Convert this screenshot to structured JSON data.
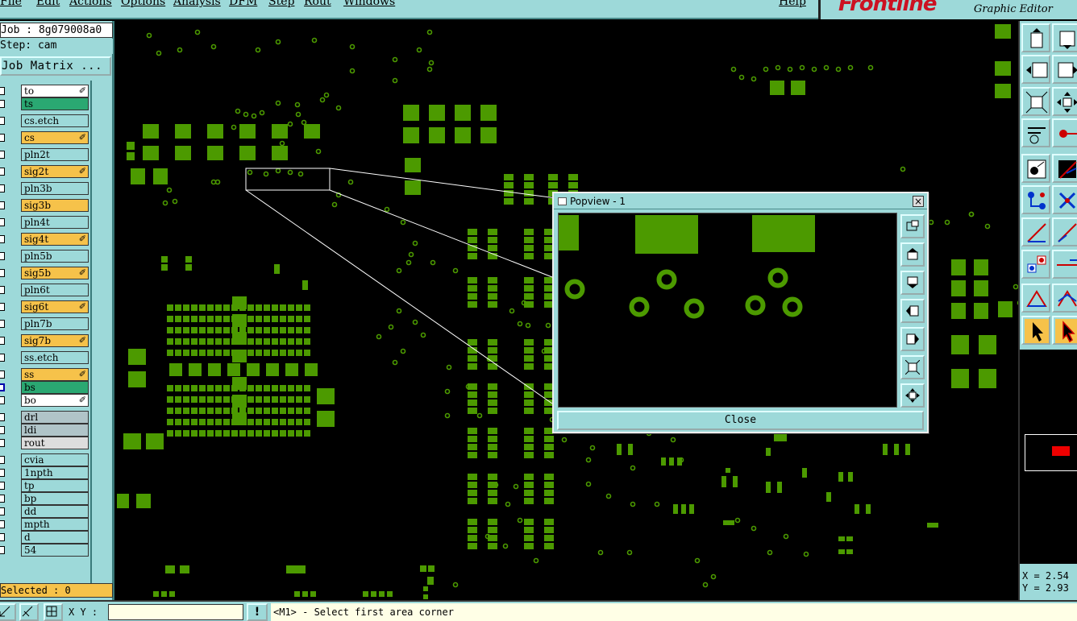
{
  "menubar": {
    "items": [
      "File",
      "Edit",
      "Actions",
      "Options",
      "Analysis",
      "DFM",
      "Step",
      "Rout",
      "Windows",
      "Help"
    ]
  },
  "brand": {
    "logo": "Frontline",
    "subtitle": "Graphic Editor"
  },
  "job": {
    "job_label": "Job : 8g079008a0",
    "step_label": "Step: cam",
    "matrix_button": "Job Matrix ..."
  },
  "layers": [
    {
      "name": "to",
      "color": "#ffffff",
      "editable": true
    },
    {
      "name": "ts",
      "color": "#2aa872",
      "editable": false
    },
    {
      "name": "cs.etch",
      "color": "#9dd9d9",
      "editable": false
    },
    {
      "name": "cs",
      "color": "#f6c24a",
      "editable": true
    },
    {
      "name": "pln2t",
      "color": "#9dd9d9",
      "editable": false
    },
    {
      "name": "sig2t",
      "color": "#f6c24a",
      "editable": true
    },
    {
      "name": "pln3b",
      "color": "#9dd9d9",
      "editable": false
    },
    {
      "name": "sig3b",
      "color": "#f6c24a",
      "editable": false
    },
    {
      "name": "pln4t",
      "color": "#9dd9d9",
      "editable": false
    },
    {
      "name": "sig4t",
      "color": "#f6c24a",
      "editable": true
    },
    {
      "name": "pln5b",
      "color": "#9dd9d9",
      "editable": false
    },
    {
      "name": "sig5b",
      "color": "#f6c24a",
      "editable": true
    },
    {
      "name": "pln6t",
      "color": "#9dd9d9",
      "editable": false
    },
    {
      "name": "sig6t",
      "color": "#f6c24a",
      "editable": true
    },
    {
      "name": "pln7b",
      "color": "#9dd9d9",
      "editable": false
    },
    {
      "name": "sig7b",
      "color": "#f6c24a",
      "editable": true
    },
    {
      "name": "ss.etch",
      "color": "#9dd9d9",
      "editable": false
    },
    {
      "name": "ss",
      "color": "#f6c24a",
      "editable": true
    },
    {
      "name": "bs",
      "color": "#2aa872",
      "editable": false
    },
    {
      "name": "bo",
      "color": "#ffffff",
      "editable": true
    },
    {
      "name": "drl",
      "color": "#b0c4c8",
      "editable": false
    },
    {
      "name": "ldi",
      "color": "#b0c4c8",
      "editable": false
    },
    {
      "name": "rout",
      "color": "#dddddd",
      "editable": false
    },
    {
      "name": "cvia",
      "color": "#9dd9d9",
      "editable": false
    },
    {
      "name": "1npth",
      "color": "#9dd9d9",
      "editable": false
    },
    {
      "name": "tp",
      "color": "#9dd9d9",
      "editable": false
    },
    {
      "name": "bp",
      "color": "#9dd9d9",
      "editable": false
    },
    {
      "name": "dd",
      "color": "#9dd9d9",
      "editable": false
    },
    {
      "name": "mpth",
      "color": "#9dd9d9",
      "editable": false
    },
    {
      "name": "d",
      "color": "#9dd9d9",
      "editable": false
    },
    {
      "name": "54",
      "color": "#9dd9d9",
      "editable": false
    }
  ],
  "selected_label": "Selected : 0",
  "popview": {
    "title": "Popview - 1",
    "close_label": "Close",
    "close_x": "×"
  },
  "coords": {
    "x": "X = 2.54",
    "y": "Y = 2.93"
  },
  "bottom": {
    "xy_label": "X Y :",
    "xy_value": "",
    "warn": "!",
    "status": "<M1> - Select first area corner"
  },
  "colors": {
    "pad": "#4c9a00",
    "panel": "#9dd9d9",
    "accent_orange": "#f6c24a",
    "accent_green": "#2aa872"
  }
}
